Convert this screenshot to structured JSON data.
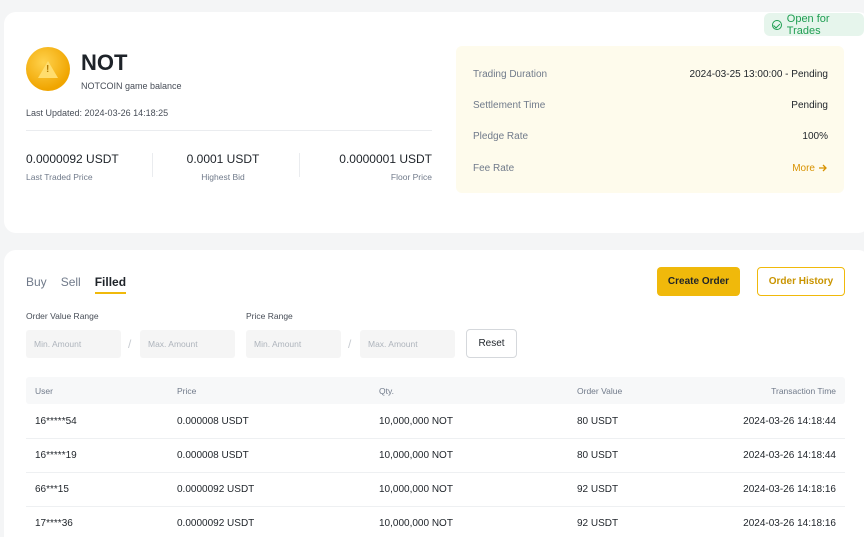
{
  "status_badge": "Open for Trades",
  "coin": {
    "symbol": "NOT",
    "subtitle": "NOTCOIN game balance",
    "last_updated": "Last Updated: 2024-03-26 14:18:25"
  },
  "stats": [
    {
      "value": "0.0000092 USDT",
      "label": "Last Traded Price"
    },
    {
      "value": "0.0001 USDT",
      "label": "Highest Bid"
    },
    {
      "value": "0.0000001 USDT",
      "label": "Floor Price"
    }
  ],
  "info": {
    "trading_duration_label": "Trading Duration",
    "trading_duration_value": "2024-03-25 13:00:00 - Pending",
    "settlement_label": "Settlement Time",
    "settlement_value": "Pending",
    "pledge_label": "Pledge Rate",
    "pledge_value": "100%",
    "fee_label": "Fee Rate",
    "fee_more": "More"
  },
  "tabs": [
    "Buy",
    "Sell",
    "Filled"
  ],
  "active_tab": "Filled",
  "actions": {
    "create_order": "Create Order",
    "order_history": "Order History"
  },
  "filters": {
    "order_value_label": "Order Value Range",
    "price_range_label": "Price Range",
    "min_placeholder": "Min. Amount",
    "max_placeholder": "Max. Amount",
    "separator": "/",
    "reset": "Reset"
  },
  "table": {
    "headers": [
      "User",
      "Price",
      "Qty.",
      "Order Value",
      "Transaction Time"
    ],
    "rows": [
      [
        "16*****54",
        "0.000008 USDT",
        "10,000,000 NOT",
        "80 USDT",
        "2024-03-26 14:18:44"
      ],
      [
        "16*****19",
        "0.000008 USDT",
        "10,000,000 NOT",
        "80 USDT",
        "2024-03-26 14:18:44"
      ],
      [
        "66***15",
        "0.0000092 USDT",
        "10,000,000 NOT",
        "92 USDT",
        "2024-03-26 14:18:16"
      ],
      [
        "17****36",
        "0.0000092 USDT",
        "10,000,000 NOT",
        "92 USDT",
        "2024-03-26 14:18:16"
      ]
    ]
  },
  "colors": {
    "accent": "#f0b90b",
    "success": "#1f9e52",
    "panel": "#fefbec"
  }
}
